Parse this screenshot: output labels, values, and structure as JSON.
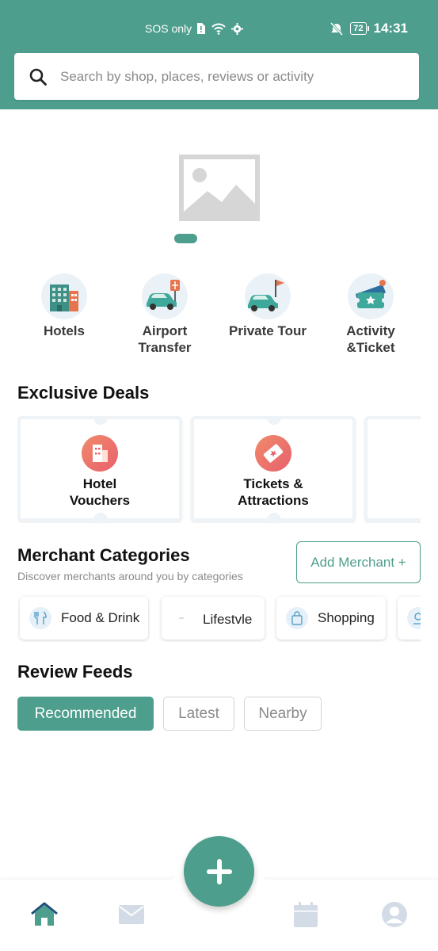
{
  "status_bar": {
    "carrier": "SOS only",
    "battery": "72",
    "time": "14:31"
  },
  "search": {
    "placeholder": "Search by shop, places, reviews or activity"
  },
  "services": [
    {
      "label": "Hotels",
      "icon": "hotel-building-icon"
    },
    {
      "label": "Airport\nTransfer",
      "icon": "airport-car-icon"
    },
    {
      "label": "Private Tour",
      "icon": "tour-car-flag-icon"
    },
    {
      "label": "Activity\n&Ticket",
      "icon": "ticket-icon"
    }
  ],
  "exclusive_deals": {
    "title": "Exclusive Deals",
    "items": [
      {
        "label": "Hotel\nVouchers",
        "icon": "hotel-voucher-icon"
      },
      {
        "label": "Tickets &\nAttractions",
        "icon": "ticket-attraction-icon"
      }
    ]
  },
  "merchant_categories": {
    "title": "Merchant Categories",
    "subtitle": "Discover merchants around you by categories",
    "add_button": "Add Merchant +",
    "items": [
      {
        "label": "Food & Drink",
        "icon": "fork-knife-icon"
      },
      {
        "label": "Lifestvle",
        "icon": "lifestyle-icon"
      },
      {
        "label": "Shopping",
        "icon": "shopping-bag-icon"
      }
    ]
  },
  "review_feeds": {
    "title": "Review Feeds",
    "tabs": [
      "Recommended",
      "Latest",
      "Nearby"
    ],
    "active_tab": "Recommended"
  },
  "bottom_nav": [
    "home-icon",
    "mail-icon",
    "add-icon",
    "calendar-icon",
    "profile-icon"
  ],
  "colors": {
    "primary": "#4e9e8d",
    "deal_gradient_start": "#f08a6a",
    "deal_gradient_end": "#e8606e"
  }
}
